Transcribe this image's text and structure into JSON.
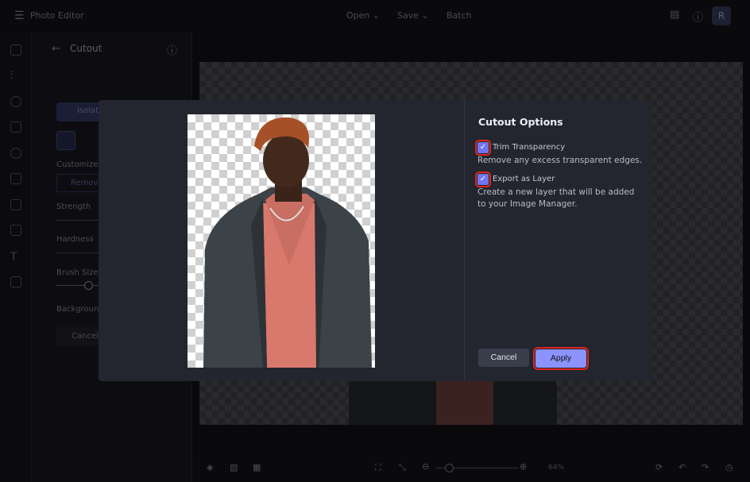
{
  "topbar": {
    "title": "Photo Editor",
    "menu": [
      "Open",
      "Save",
      "Batch"
    ],
    "avatar": "R"
  },
  "panel": {
    "title": "Cutout",
    "isolate_tab": "Isolat",
    "customize_label": "Customize",
    "remove_button": "Removi",
    "strength_label": "Strength",
    "hardness_label": "Hardness",
    "brush_size_label": "Brush Size",
    "background_label": "Background",
    "cancel_label": "Cancel",
    "brush_size_value": 0.55
  },
  "bottombar": {
    "zoom": "64%"
  },
  "dialog": {
    "title": "Cutout Options",
    "options": [
      {
        "label": "Trim Transparency",
        "description": "Remove any excess transparent edges.",
        "checked": true
      },
      {
        "label": "Export as Layer",
        "description": "Create a new layer that will be added to your Image Manager.",
        "checked": true
      }
    ],
    "cancel_label": "Cancel",
    "apply_label": "Apply"
  },
  "colors": {
    "accent": "#6f74f0",
    "apply": "#8b93ff",
    "highlight": "#e0261b",
    "dialog_bg": "#23252f"
  }
}
